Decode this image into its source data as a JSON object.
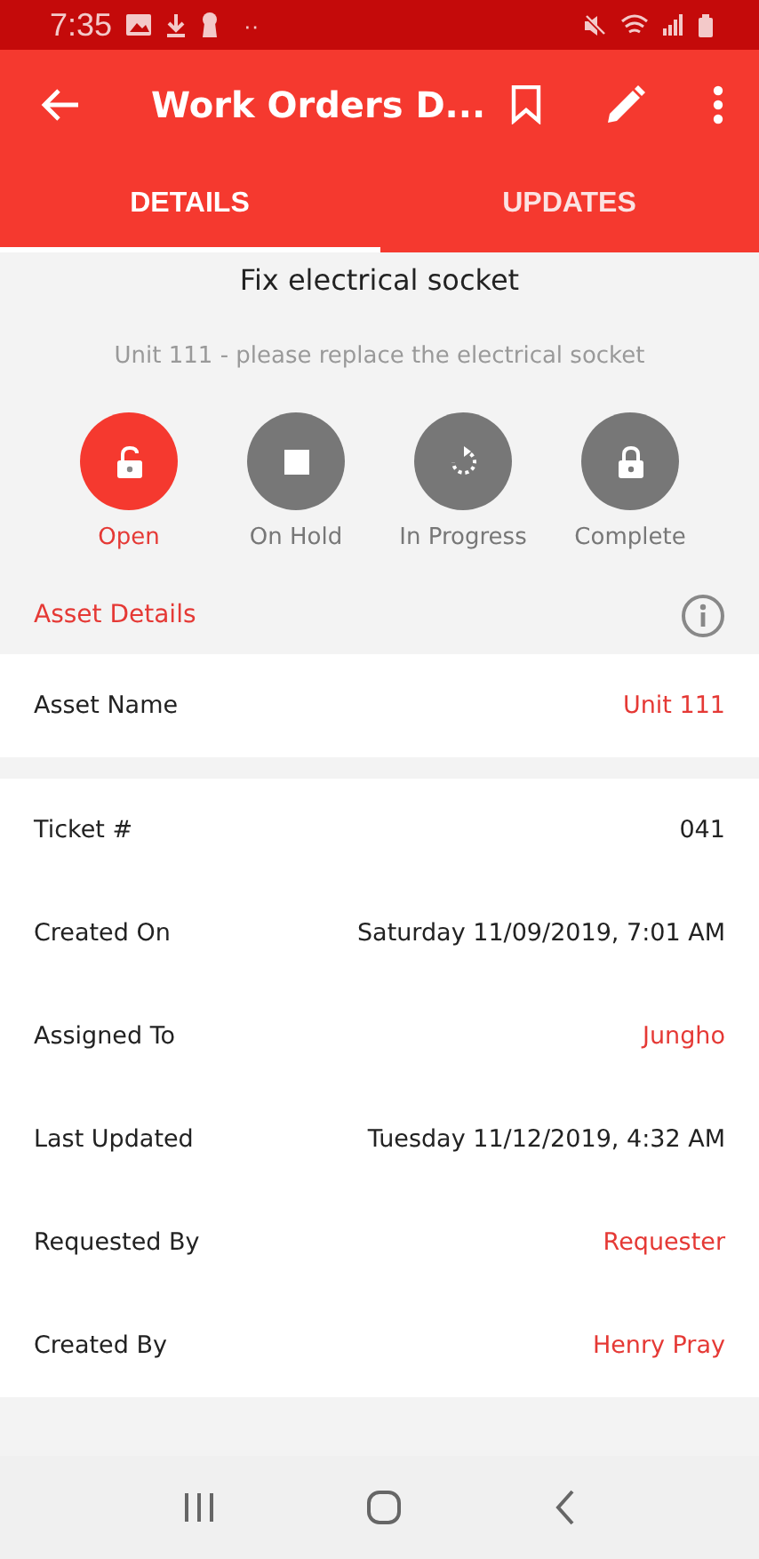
{
  "status_bar": {
    "time": "7:35",
    "extra": "··"
  },
  "app_bar": {
    "title": "Work Orders D..."
  },
  "tabs": [
    {
      "label": "DETAILS",
      "selected": true
    },
    {
      "label": "UPDATES",
      "selected": false
    }
  ],
  "work_order": {
    "title": "Fix electrical socket",
    "description": "Unit 111 - please replace the electrical socket"
  },
  "statuses": [
    {
      "label": "Open",
      "kind": "unlock",
      "selected": true
    },
    {
      "label": "On Hold",
      "kind": "stop",
      "selected": false
    },
    {
      "label": "In Progress",
      "kind": "progress",
      "selected": false
    },
    {
      "label": "Complete",
      "kind": "lock",
      "selected": false
    }
  ],
  "asset_section": {
    "title": "Asset Details",
    "rows": [
      {
        "label": "Asset Name",
        "value": "Unit 111",
        "link": true
      }
    ]
  },
  "details": [
    {
      "label": "Ticket #",
      "value": "041",
      "link": false
    },
    {
      "label": "Created On",
      "value": "Saturday 11/09/2019, 7:01 AM",
      "link": false
    },
    {
      "label": "Assigned To",
      "value": "Jungho",
      "link": true
    },
    {
      "label": "Last Updated",
      "value": "Tuesday 11/12/2019, 4:32 AM",
      "link": false
    },
    {
      "label": "Requested By",
      "value": "Requester",
      "link": true
    },
    {
      "label": "Created By",
      "value": "Henry Pray",
      "link": true
    }
  ]
}
